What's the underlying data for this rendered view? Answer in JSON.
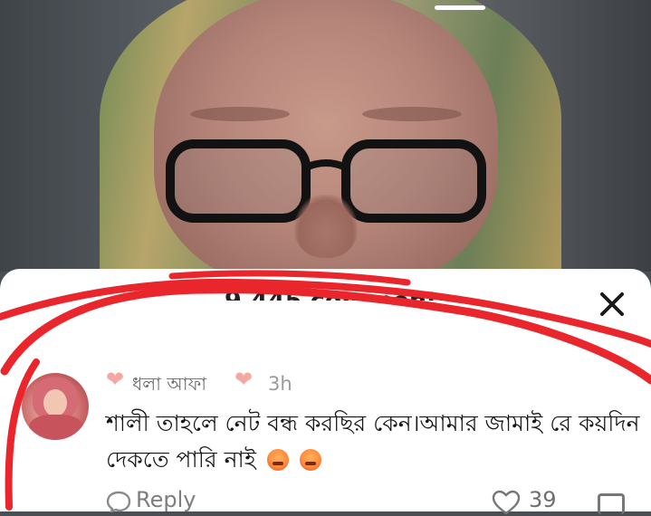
{
  "comments_sheet": {
    "count_label": "9,445 comments",
    "close_icon": "close-icon"
  },
  "comment": {
    "author": "ধলা আফা",
    "timestamp": "3h",
    "text": "শালী তাহলে নেট বন্ধ করছির কেন।আমার জামাই রে কয়দিন দেকতে পারি নাই",
    "emojis": [
      "angry-face-emoji",
      "angry-face-emoji"
    ],
    "reply_label": "Reply",
    "like_count": "39"
  },
  "colors": {
    "annotation_red": "#e8262c",
    "heart_pink": "#f4a8a2"
  }
}
